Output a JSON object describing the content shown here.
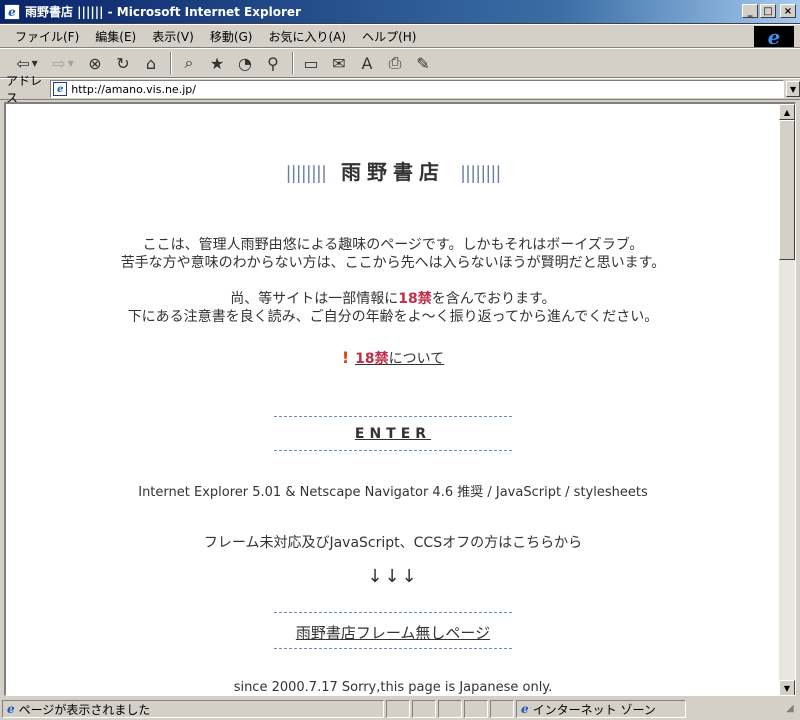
{
  "window": {
    "title": "雨野書店 ||||||  - Microsoft Internet Explorer",
    "minimize": "_",
    "maximize": "□",
    "close": "×"
  },
  "menu": [
    "ファイル(F)",
    "編集(E)",
    "表示(V)",
    "移動(G)",
    "お気に入り(A)",
    "ヘルプ(H)"
  ],
  "toolbar": {
    "icons": [
      "back-icon",
      "forward-icon",
      "stop-icon",
      "refresh-icon",
      "home-icon",
      "search-icon",
      "favorites-icon",
      "history-icon",
      "channels-icon",
      "fullscreen-icon",
      "mail-icon",
      "font-icon",
      "print-icon",
      "edit-icon"
    ]
  },
  "address": {
    "label": "アドレス",
    "url": "http://amano.vis.ne.jp/"
  },
  "page": {
    "title_deco_left": "||||||||",
    "title": "雨野書店",
    "title_deco_right": "||||||||",
    "intro_line1": "ここは、管理人雨野由悠による趣味のページです。しかもそれはボーイズラブ。",
    "intro_line2": "苦手な方や意味のわからない方は、ここから先へは入らないほうが賢明だと思います。",
    "notice_line1_before": "尚、等サイトは一部情報に",
    "notice_r18": "18禁",
    "notice_line1_after": "を含んでおります。",
    "notice_line2": "下にある注意書を良く読み、ご自分の年齢をよ～く振り返ってから進んでください。",
    "r18_link_r18": "18禁",
    "r18_link_rest": "について",
    "enter": "ENTER",
    "browser_note": "Internet Explorer 5.01 & Netscape Navigator 4.6 推奨 / JavaScript / stylesheets",
    "noframes_text": "フレーム未対応及びJavaScript、CCSオフの方はこちらから",
    "arrows": "↓↓↓",
    "noframes_link": "雨野書店フレーム無しページ",
    "since": "since 2000.7.17   Sorry,this page is Japanese only."
  },
  "status": {
    "text": "ページが表示されました",
    "zone": "インターネット ゾーン"
  }
}
